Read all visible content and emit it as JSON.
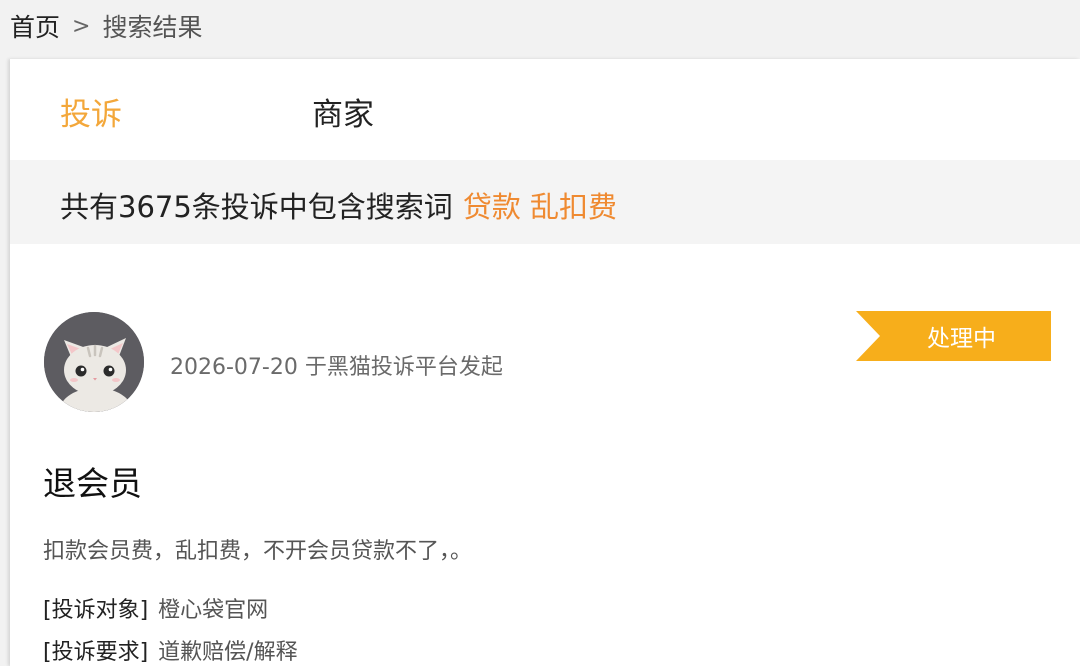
{
  "breadcrumb": {
    "home": "首页",
    "separator": ">",
    "current": "搜索结果"
  },
  "tabs": [
    {
      "label": "投诉",
      "active": true
    },
    {
      "label": "商家",
      "active": false
    }
  ],
  "result_summary": {
    "text": "共有3675条投诉中包含搜索词",
    "keywords": "贷款 乱扣费"
  },
  "complaint": {
    "avatar_icon": "cat-avatar-icon",
    "meta": "2026-07-20 于黑猫投诉平台发起",
    "status": "处理中",
    "title": "退会员",
    "description": "扣款会员费，乱扣费，不开会员贷款不了，。",
    "target_label": "[投诉对象]",
    "target_value": "橙心袋官网",
    "demand_label": "[投诉要求]",
    "demand_value": "道歉赔偿/解释"
  },
  "colors": {
    "accent": "#f3a73a",
    "keyword": "#ef8a31",
    "status_bg": "#f7ae1b"
  }
}
